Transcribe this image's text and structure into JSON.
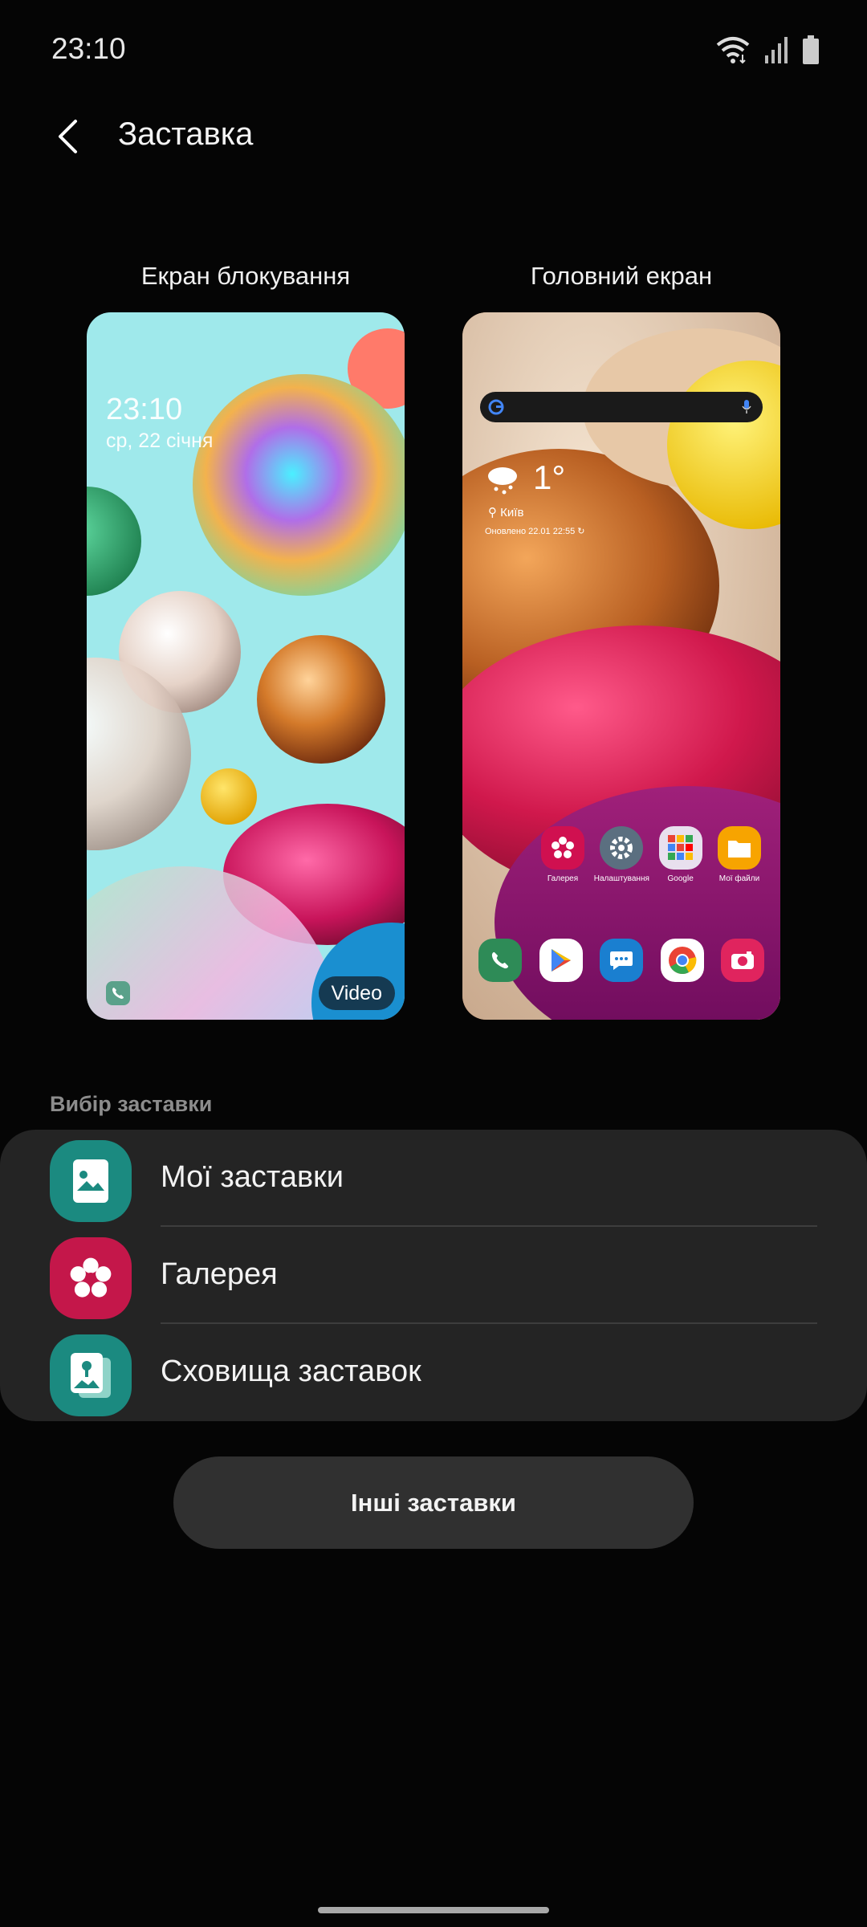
{
  "status_bar": {
    "time": "23:10"
  },
  "header": {
    "title": "Заставка"
  },
  "previews": {
    "lock": {
      "label": "Екран блокування",
      "time": "23:10",
      "date": "ср, 22 січня",
      "badge": "Video"
    },
    "home": {
      "label": "Головний екран",
      "weather": {
        "temp": "1°",
        "city": "Київ",
        "updated": "Оновлено 22.01 22:55"
      },
      "apps": [
        {
          "label": "Галерея",
          "icon": "gallery-icon"
        },
        {
          "label": "Налаштування",
          "icon": "settings-icon"
        },
        {
          "label": "Google",
          "icon": "google-folder-icon"
        },
        {
          "label": "Мої файли",
          "icon": "my-files-icon"
        }
      ],
      "dock": [
        "phone-icon",
        "play-store-icon",
        "messages-icon",
        "chrome-icon",
        "camera-icon"
      ]
    }
  },
  "section": {
    "label": "Вибір заставки"
  },
  "options": [
    {
      "label": "Мої заставки",
      "icon": "my-wallpapers-icon",
      "color": "#1b8a80"
    },
    {
      "label": "Галерея",
      "icon": "gallery-flower-icon",
      "color": "#c4174a"
    },
    {
      "label": "Сховища заставок",
      "icon": "wallpaper-storage-icon",
      "color": "#1b8a80"
    }
  ],
  "other_button": {
    "label": "Інші заставки"
  }
}
